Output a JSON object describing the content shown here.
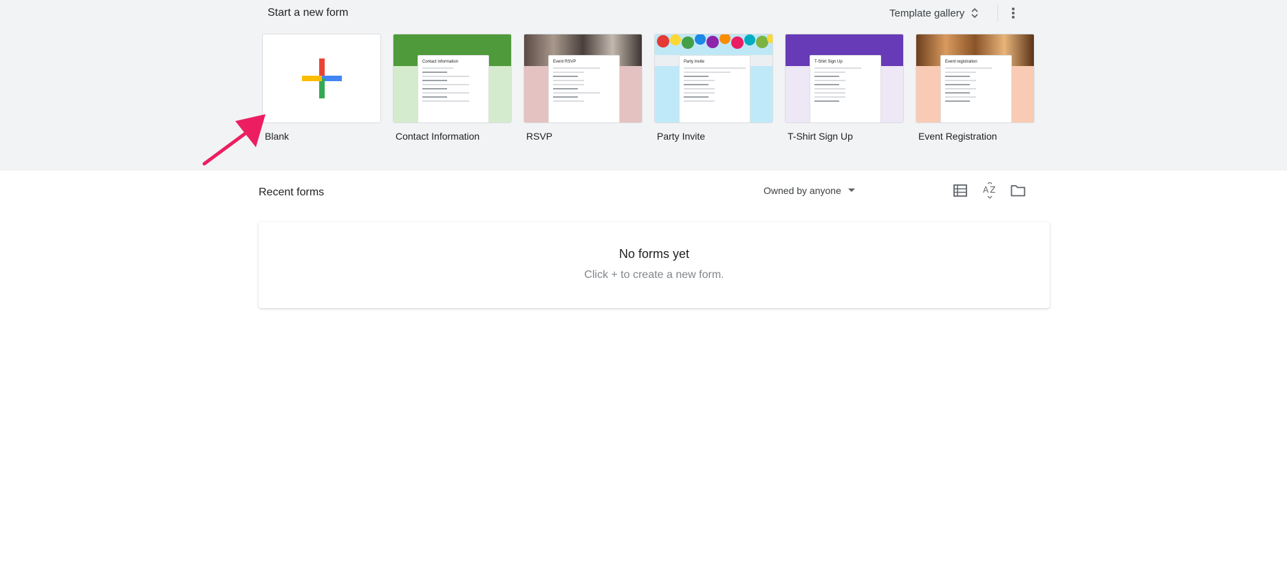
{
  "header": {
    "section_title": "Start a new form",
    "template_gallery_label": "Template gallery"
  },
  "templates": [
    {
      "label": "Blank",
      "icon": "plus-icon"
    },
    {
      "label": "Contact Information",
      "form_title": "Contact information",
      "color": "#6aa84f"
    },
    {
      "label": "RSVP",
      "form_title": "Event RSVP",
      "color": "#e2bebe"
    },
    {
      "label": "Party Invite",
      "form_title": "Party Invite",
      "color": "#bfe8f7"
    },
    {
      "label": "T-Shirt Sign Up",
      "form_title": "T-Shirt Sign Up",
      "color": "#673ab7"
    },
    {
      "label": "Event Registration",
      "form_title": "Event registration",
      "color": "#f9cbb5"
    }
  ],
  "recent": {
    "title": "Recent forms",
    "owner_filter": "Owned by anyone",
    "empty_title": "No forms yet",
    "empty_hint": "Click + to create a new form."
  },
  "colors": {
    "top_bg": "#f1f3f4",
    "arrow": "#ec1e61",
    "plus_red": "#ea4335",
    "plus_blue": "#4285f4",
    "plus_green": "#34a853",
    "plus_yellow": "#fbbc04"
  }
}
